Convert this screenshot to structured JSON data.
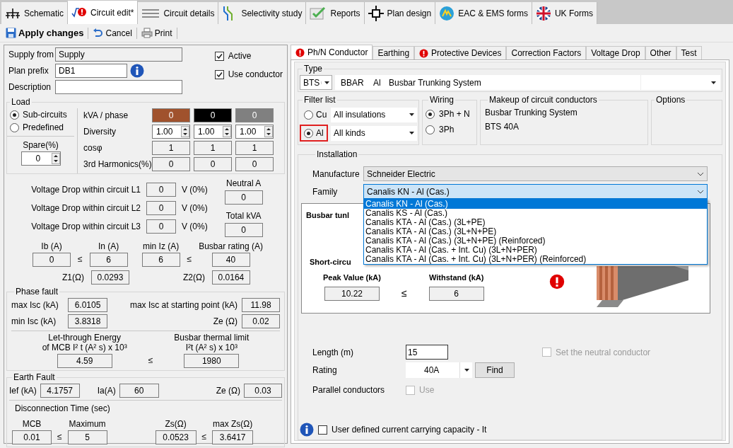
{
  "app_tabs": [
    {
      "label": "Schematic",
      "kind": "schematic",
      "selected": false
    },
    {
      "label": "Circuit edit*",
      "kind": "warning",
      "selected": true
    },
    {
      "label": "Circuit details",
      "kind": "lines",
      "selected": false
    },
    {
      "label": "Selectivity study",
      "kind": "curves",
      "selected": false
    },
    {
      "label": "Reports",
      "kind": "report",
      "selected": false
    },
    {
      "label": "Plan design",
      "kind": "plan",
      "selected": false
    },
    {
      "label": "EAC & EMS forms",
      "kind": "badge",
      "selected": false
    },
    {
      "label": "UK Forms",
      "kind": "flag",
      "selected": false
    }
  ],
  "toolbar": [
    {
      "label": "Apply changes",
      "kind": "save"
    },
    {
      "label": "Cancel",
      "kind": "undo"
    },
    {
      "label": "Print",
      "kind": "print"
    }
  ],
  "circuit": {
    "supply_from": {
      "label": "Supply from",
      "value": "Supply"
    },
    "plan_prefix": {
      "label": "Plan prefix",
      "value": "DB1"
    },
    "description": {
      "label": "Description"
    },
    "active": {
      "label": "Active",
      "checked": true
    },
    "use_conductor": {
      "label": "Use conductor",
      "checked": true
    }
  },
  "load": {
    "title": "Load",
    "options": [
      {
        "label": "Sub-circuits",
        "selected": true
      },
      {
        "label": "Predefined",
        "selected": false
      }
    ],
    "spare": {
      "label": "Spare(%)",
      "value": "0"
    },
    "rows": [
      {
        "label": "kVA / phase",
        "kind": "phase",
        "cells": [
          {
            "value": "0",
            "color": "#a0522d"
          },
          {
            "value": "0",
            "color": "#000000"
          },
          {
            "value": "0",
            "color": "#808080"
          }
        ]
      },
      {
        "label": "Diversity",
        "kind": "spin",
        "cells": [
          {
            "value": "1.00"
          },
          {
            "value": "1.00"
          },
          {
            "value": "1.00"
          }
        ]
      },
      {
        "label": "cosφ",
        "kind": "readonly",
        "cells": [
          {
            "value": "1"
          },
          {
            "value": "1"
          },
          {
            "value": "1"
          }
        ]
      },
      {
        "label": "3rd Harmonics(%)",
        "kind": "readonly",
        "cells": [
          {
            "value": "0"
          },
          {
            "value": "0"
          },
          {
            "value": "0"
          }
        ]
      }
    ]
  },
  "voltage_drops": [
    {
      "label": "Voltage Drop within circuit L1",
      "value": "0",
      "unit": "V (0%)"
    },
    {
      "label": "Voltage Drop within circuit L2",
      "value": "0",
      "unit": "V (0%)"
    },
    {
      "label": "Voltage Drop within circuit L3",
      "value": "0",
      "unit": "V (0%)"
    }
  ],
  "neutral_a": {
    "label": "Neutral A",
    "value": "0"
  },
  "total_kva": {
    "label": "Total kVA",
    "value": "0"
  },
  "currents": [
    {
      "label": "Ib (A)",
      "value": "0"
    },
    {
      "label": "In (A)",
      "value": "6"
    },
    {
      "label": "min Iz (A)",
      "value": "6"
    },
    {
      "label": "Busbar rating (A)",
      "value": "40"
    }
  ],
  "current_relations": [
    "≤",
    "≤"
  ],
  "impedances": [
    {
      "label": "Z1(Ω)",
      "value": "0.0293"
    },
    {
      "label": "Z2(Ω)",
      "value": "0.0164"
    }
  ],
  "phase_fault": {
    "title": "Phase fault",
    "fields": [
      {
        "label": "max Isc (kA)",
        "value": "6.0105"
      },
      {
        "label": "max Isc at starting point (kA)",
        "value": "11.98"
      },
      {
        "label": "min Isc (kA)",
        "value": "3.8318"
      },
      {
        "label": "Ze (Ω)",
        "value": "0.02"
      }
    ],
    "energy": {
      "lines": [
        "Let-through Energy",
        "of MCB I² t (A² s)  x 10³"
      ],
      "value": "4.59"
    },
    "relation": "≤",
    "thermal": {
      "lines": [
        "Busbar thermal limit",
        "I²t (A² s)  x 10³"
      ],
      "value": "1980"
    }
  },
  "earth_fault": {
    "title": "Earth Fault",
    "fields": [
      {
        "label": "Ief (kA)",
        "value": "4.1757"
      },
      {
        "label": "Ia(A)",
        "value": "60"
      },
      {
        "label": "Ze (Ω)",
        "value": "0.03"
      }
    ],
    "disconnection_title": "Disconnection Time (sec)",
    "items": [
      {
        "label": "MCB",
        "value": "0.01"
      },
      {
        "label": "Maximum",
        "value": "5"
      },
      {
        "label": "Zs(Ω)",
        "value": "0.0523"
      },
      {
        "label": "max Zs(Ω)",
        "value": "3.6417"
      }
    ],
    "relations": [
      "≤",
      "≤"
    ]
  },
  "detail_tabs": [
    {
      "label": "Ph/N Conductor",
      "selected": true,
      "warning": true
    },
    {
      "label": "Earthing",
      "selected": false,
      "warning": false
    },
    {
      "label": "Protective Devices",
      "selected": false,
      "warning": true
    },
    {
      "label": "Correction Factors",
      "selected": false,
      "warning": false
    },
    {
      "label": "Voltage Drop",
      "selected": false,
      "warning": false
    },
    {
      "label": "Other",
      "selected": false,
      "warning": false
    },
    {
      "label": "Test",
      "selected": false,
      "warning": false
    }
  ],
  "type": {
    "title": "Type",
    "code": "BTS",
    "columns": [
      "BBAR",
      "Al",
      "Busbar Trunking System"
    ]
  },
  "filter_list": {
    "title": "Filter list",
    "materials": [
      {
        "label": "Cu",
        "selected": false,
        "highlighted": false
      },
      {
        "label": "Al",
        "selected": true,
        "highlighted": true
      }
    ],
    "dropdowns": [
      "All insulations",
      "All kinds"
    ]
  },
  "wiring": {
    "title": "Wiring",
    "options": [
      {
        "label": "3Ph + N",
        "selected": true
      },
      {
        "label": "3Ph",
        "selected": false
      }
    ]
  },
  "makeup": {
    "title": "Makeup of circuit conductors",
    "lines": [
      "Busbar Trunking System",
      "BTS 40A"
    ]
  },
  "options": {
    "title": "Options"
  },
  "installation": {
    "title": "Installation",
    "manufacture": {
      "label": "Manufacture",
      "value": "Schneider Electric"
    },
    "family": {
      "label": "Family",
      "value": "Canalis KN - Al (Cas.)",
      "expanded": true,
      "options": [
        {
          "label": "Canalis KN - Al (Cas.)",
          "selected": true
        },
        {
          "label": "Canalis KS - Al (Cas.)",
          "selected": false
        },
        {
          "label": "Canalis KTA - Al (Cas.) (3L+PE)",
          "selected": false
        },
        {
          "label": "Canalis KTA - Al (Cas.) (3L+N+PE)",
          "selected": false
        },
        {
          "label": "Canalis KTA - Al (Cas.) (3L+N+PE) (Reinforced)",
          "selected": false
        },
        {
          "label": "Canalis KTA - Al (Cas. + Int. Cu) (3L+N+PER)",
          "selected": false
        },
        {
          "label": "Canalis KTA - Al (Cas. + Int. Cu) (3L+N+PER) (Reinforced)",
          "selected": false
        }
      ]
    }
  },
  "busbar_card": {
    "title": "Busbar tunl",
    "short_circuit": "Short-circu",
    "peak": {
      "label": "Peak Value (kA)",
      "value": "10.22"
    },
    "relation": "≤",
    "withstand": {
      "label": "Withstand (kA)",
      "value": "6"
    },
    "warning": true
  },
  "length": {
    "label": "Length (m)",
    "value": "15"
  },
  "rating": {
    "label": "Rating",
    "value": "40A",
    "button": "Find"
  },
  "parallel": {
    "label": "Parallel conductors",
    "checkbox": {
      "label": "Use",
      "checked": false,
      "disabled": true
    }
  },
  "neutral": {
    "label": "Set the neutral conductor",
    "checked": false,
    "disabled": true
  },
  "user_defined": {
    "label": "User defined current carrying capacity - It",
    "checked": false
  }
}
